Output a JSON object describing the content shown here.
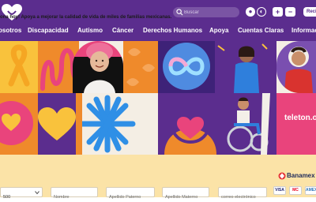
{
  "header": {
    "search": {
      "placeholder": "Buscar"
    },
    "a11y": {
      "contrast_label": "●",
      "grayscale_label": "◐"
    },
    "font_size": {
      "increase_label": "+",
      "decrease_label": "−"
    },
    "login_label": "Recibo"
  },
  "nav": {
    "items": [
      {
        "label": "osotros"
      },
      {
        "label": "Discapacidad"
      },
      {
        "label": "Autismo"
      },
      {
        "label": "Cáncer"
      },
      {
        "label": "Derechos Humanos"
      },
      {
        "label": "Apoya"
      },
      {
        "label": "Cuentas Claras"
      },
      {
        "label": "Informac"
      }
    ]
  },
  "hero": {
    "teleton_logo_text": "teleton.o"
  },
  "donation": {
    "headline": "ona hoy! Apoya a mejorar la calidad de vida de miles de familias mexicanas.",
    "bank_name": "Banamex",
    "fields": {
      "amount_value": "500",
      "name_placeholder": "Nombre",
      "paternal_placeholder": "Apellido Paterno",
      "maternal_placeholder": "Apellido Materno",
      "email_placeholder": "correo electrónico"
    },
    "cards": [
      {
        "label": "VISA"
      },
      {
        "label": "MC"
      },
      {
        "label": "AMEX"
      }
    ]
  },
  "colors": {
    "brand_purple": "#5b2d8e",
    "deep_purple": "#3e2278",
    "orange": "#ef8a2b",
    "pink": "#e9447c",
    "blue": "#2f7fdc",
    "yellow": "#f9c23c",
    "cream": "#fbe3a7",
    "red": "#e53238"
  }
}
